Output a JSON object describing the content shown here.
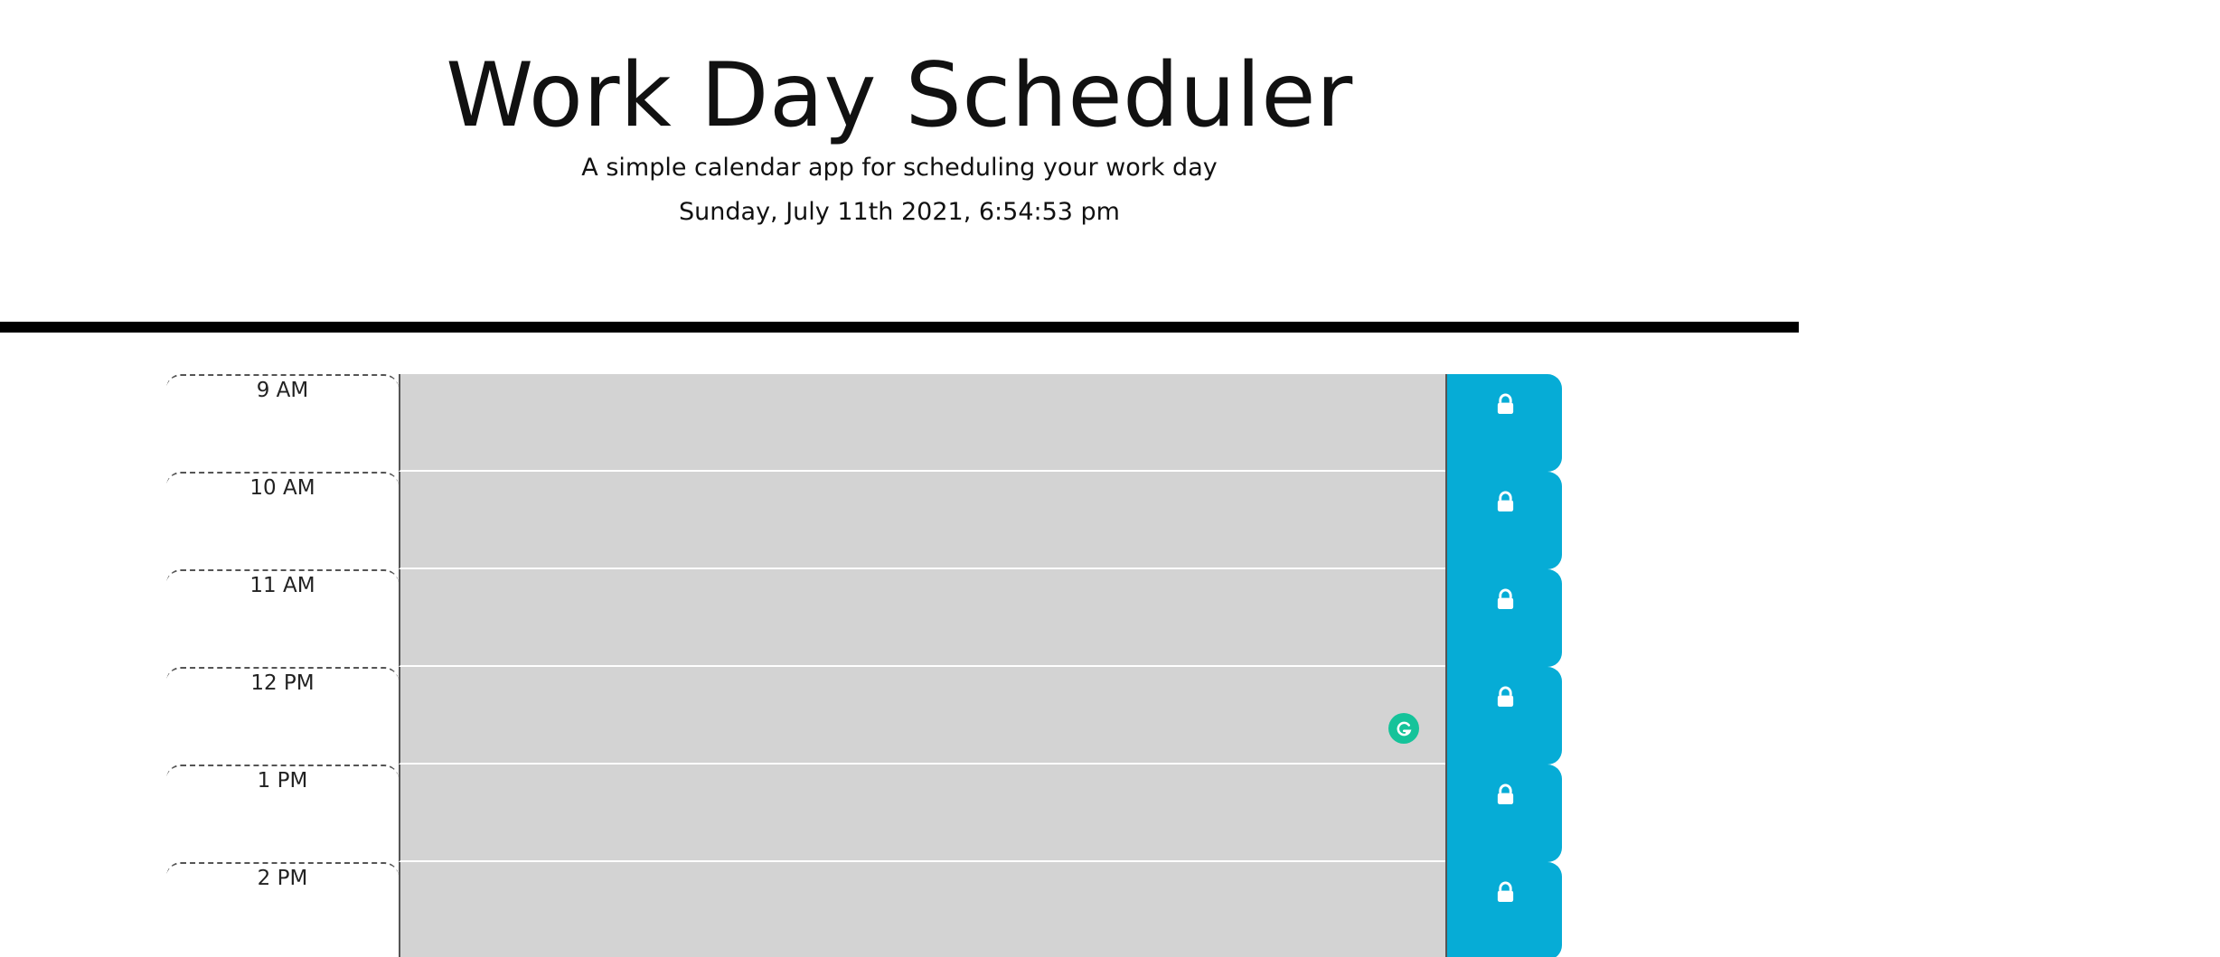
{
  "header": {
    "title": "Work Day Scheduler",
    "subtitle": "A simple calendar app for scheduling your work day",
    "current_datetime": "Sunday, July 11th 2021, 6:54:53 pm"
  },
  "schedule": {
    "time_blocks": [
      {
        "hour": "9 AM",
        "description": "",
        "save_icon": "lock-icon"
      },
      {
        "hour": "10 AM",
        "description": "",
        "save_icon": "lock-icon"
      },
      {
        "hour": "11 AM",
        "description": "",
        "save_icon": "lock-icon"
      },
      {
        "hour": "12 PM",
        "description": "",
        "save_icon": "lock-icon"
      },
      {
        "hour": "1 PM",
        "description": "",
        "save_icon": "lock-icon"
      },
      {
        "hour": "2 PM",
        "description": "",
        "save_icon": "lock-icon"
      }
    ]
  },
  "colors": {
    "past_block": "#d3d3d3",
    "save_button": "#06acd6",
    "grammarly": "#15c39a",
    "header_rule": "#000000"
  },
  "icons": {
    "save": "lock-icon",
    "extension": "grammarly-icon"
  }
}
